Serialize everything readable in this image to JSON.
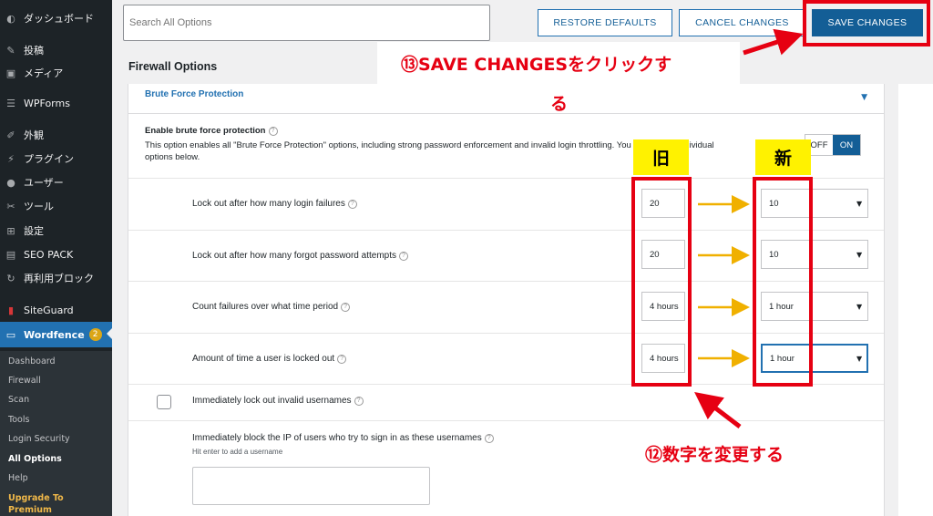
{
  "sidebar": {
    "items": [
      {
        "label": "ダッシュボード",
        "icon": "dashboard-icon",
        "glyph": "◐"
      },
      {
        "label": "投稿",
        "icon": "pin-icon",
        "glyph": "✎"
      },
      {
        "label": "メディア",
        "icon": "media-icon",
        "glyph": "▣"
      },
      {
        "label": "WPForms",
        "icon": "form-icon",
        "glyph": "☰"
      },
      {
        "label": "外観",
        "icon": "brush-icon",
        "glyph": "✐"
      },
      {
        "label": "プラグイン",
        "icon": "plugin-icon",
        "glyph": "⚡"
      },
      {
        "label": "ユーザー",
        "icon": "user-icon",
        "glyph": "●"
      },
      {
        "label": "ツール",
        "icon": "wrench-icon",
        "glyph": "✂"
      },
      {
        "label": "設定",
        "icon": "settings-icon",
        "glyph": "⊞"
      },
      {
        "label": "SEO PACK",
        "icon": "seo-pack-icon",
        "glyph": "▤"
      },
      {
        "label": "再利用ブロック",
        "icon": "reuse-block-icon",
        "glyph": "↻"
      },
      {
        "label": "SiteGuard",
        "icon": "siteguard-icon",
        "glyph": "▮"
      },
      {
        "label": "Wordfence",
        "icon": "wordfence-icon",
        "glyph": "▭",
        "badge": "2"
      }
    ],
    "submenu": [
      "Dashboard",
      "Firewall",
      "Scan",
      "Tools",
      "Login Security",
      "All Options",
      "Help"
    ],
    "upgrade": [
      "Upgrade To",
      "Premium"
    ]
  },
  "topbar": {
    "search_placeholder": "Search All Options",
    "restore_label": "RESTORE DEFAULTS",
    "cancel_label": "CANCEL CHANGES",
    "save_label": "SAVE CHANGES"
  },
  "section_title": "Firewall Options",
  "panel": {
    "header": "Brute Force Protection",
    "enable_title": "Enable brute force protection",
    "enable_desc_line1": "This option enables all \"Brute Force Protection\" options, including strong password enforcement and invalid login throttling. You can modify individual",
    "enable_desc_line2": "options below.",
    "toggle_off": "OFF",
    "toggle_on": "ON",
    "rows": [
      {
        "label": "Lock out after how many login failures",
        "old": "20",
        "new": "10"
      },
      {
        "label": "Lock out after how many forgot password attempts",
        "old": "20",
        "new": "10"
      },
      {
        "label": "Count failures over what time period",
        "old": "4 hours",
        "new": "1 hour"
      },
      {
        "label": "Amount of time a user is locked out",
        "old": "4 hours",
        "new": "1 hour"
      }
    ],
    "invalid_usernames_label": "Immediately lock out invalid usernames",
    "block_ip_label": "Immediately block the IP of users who try to sign in as these usernames",
    "block_ip_hint": "Hit enter to add a username"
  },
  "annotations": {
    "old_label": "旧",
    "new_label": "新",
    "save_instruction_line1": "⑬SAVE CHANGESをクリックす",
    "save_instruction_line2": "る",
    "change_instruction": "⑫数字を変更する",
    "red": "#e60012",
    "yellow": "#fff200",
    "arrow_gold": "#f0b000"
  },
  "colors": {
    "wp_blue": "#2271b1",
    "wp_dark": "#1d2327",
    "sidebar_sub": "#2c3338"
  }
}
